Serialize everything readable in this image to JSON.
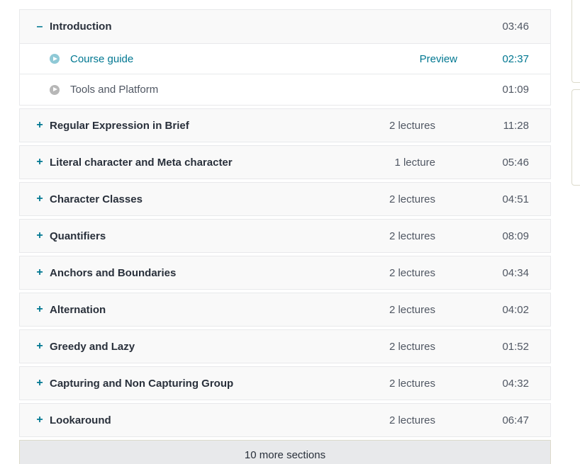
{
  "sections": [
    {
      "toggle": "–",
      "title": "Introduction",
      "count": "",
      "duration": "03:46",
      "open": true,
      "lectures": [
        {
          "title": "Course guide",
          "preview": "Preview",
          "duration": "02:37",
          "link": true
        },
        {
          "title": "Tools and Platform",
          "preview": "",
          "duration": "01:09",
          "link": false
        }
      ]
    },
    {
      "toggle": "+",
      "title": "Regular Expression in Brief",
      "count": "2 lectures",
      "duration": "11:28"
    },
    {
      "toggle": "+",
      "title": "Literal character and Meta character",
      "count": "1 lecture",
      "duration": "05:46"
    },
    {
      "toggle": "+",
      "title": "Character Classes",
      "count": "2 lectures",
      "duration": "04:51"
    },
    {
      "toggle": "+",
      "title": "Quantifiers",
      "count": "2 lectures",
      "duration": "08:09"
    },
    {
      "toggle": "+",
      "title": "Anchors and Boundaries",
      "count": "2 lectures",
      "duration": "04:34"
    },
    {
      "toggle": "+",
      "title": "Alternation",
      "count": "2 lectures",
      "duration": "04:02"
    },
    {
      "toggle": "+",
      "title": "Greedy and Lazy",
      "count": "2 lectures",
      "duration": "01:52"
    },
    {
      "toggle": "+",
      "title": "Capturing and Non Capturing Group",
      "count": "2 lectures",
      "duration": "04:32"
    },
    {
      "toggle": "+",
      "title": "Lookaround",
      "count": "2 lectures",
      "duration": "06:47"
    }
  ],
  "more_sections_label": "10 more sections",
  "colors": {
    "accent": "#007791",
    "text": "#29303b",
    "muted": "#505763"
  }
}
